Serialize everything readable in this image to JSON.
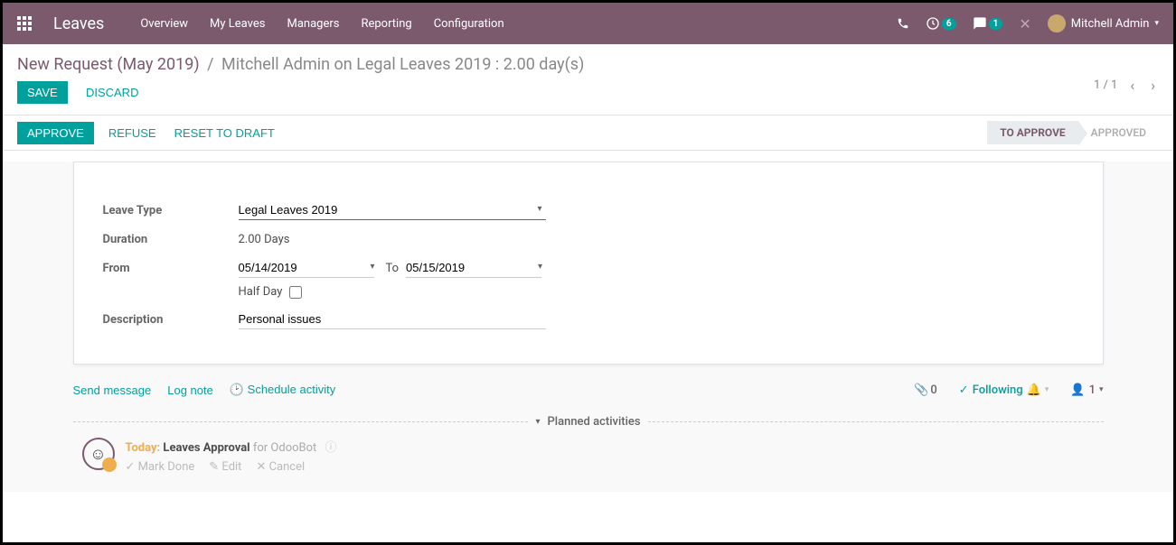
{
  "nav": {
    "brand": "Leaves",
    "links": [
      "Overview",
      "My Leaves",
      "Managers",
      "Reporting",
      "Configuration"
    ],
    "activity_badge": "6",
    "discuss_badge": "1",
    "user": "Mitchell Admin"
  },
  "breadcrumb": {
    "parent": "New Request (May 2019)",
    "current": "Mitchell Admin on Legal Leaves 2019 : 2.00 day(s)"
  },
  "pager": {
    "text": "1 / 1"
  },
  "edit": {
    "save": "SAVE",
    "discard": "DISCARD"
  },
  "status": {
    "approve": "APPROVE",
    "refuse": "REFUSE",
    "reset": "RESET TO DRAFT",
    "stages": {
      "to_approve": "TO APPROVE",
      "approved": "APPROVED"
    }
  },
  "form": {
    "labels": {
      "leave_type": "Leave Type",
      "duration": "Duration",
      "from": "From",
      "to": "To",
      "half_day": "Half Day",
      "description": "Description"
    },
    "values": {
      "leave_type": "Legal Leaves 2019",
      "duration": "2.00  Days",
      "from": "05/14/2019",
      "to": "05/15/2019",
      "description": "Personal issues"
    }
  },
  "chatter": {
    "send_message": "Send message",
    "log_note": "Log note",
    "schedule_activity": "Schedule activity",
    "attachments": "0",
    "following": "Following",
    "followers": "1",
    "section": "Planned activities",
    "activity": {
      "today": "Today:",
      "title": "Leaves Approval",
      "for_text": "for OdooBot",
      "mark_done": "Mark Done",
      "edit": "Edit",
      "cancel": "Cancel"
    }
  }
}
